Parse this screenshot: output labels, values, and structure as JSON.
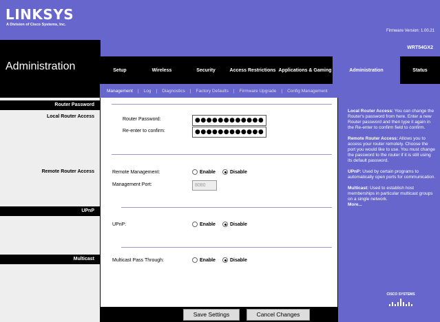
{
  "header": {
    "brand": "LINKSYS",
    "brand_sub": "A Division of Cisco Systems, Inc.",
    "firmware": "Firmware Version: 1.00.21",
    "model": "WRT54GX2",
    "page_title": "Administration"
  },
  "tabs": [
    {
      "label": "Setup",
      "active": false
    },
    {
      "label": "Wireless",
      "active": false
    },
    {
      "label": "Security",
      "active": false
    },
    {
      "label": "Access Restrictions",
      "active": false
    },
    {
      "label": "Applications & Gaming",
      "active": false
    },
    {
      "label": "Administration",
      "active": true
    },
    {
      "label": "Status",
      "active": false
    }
  ],
  "subnav": [
    {
      "label": "Management",
      "active": true
    },
    {
      "label": "Log",
      "active": false
    },
    {
      "label": "Diagnostics",
      "active": false
    },
    {
      "label": "Factory Defaults",
      "active": false
    },
    {
      "label": "Firmware Upgrade",
      "active": false
    },
    {
      "label": "Config Management",
      "active": false
    }
  ],
  "left": {
    "router_password": "Router Password",
    "local_access": "Local Router Access",
    "remote_access": "Remote Router Access",
    "upnp": "UPnP",
    "multicast": "Multicast"
  },
  "form": {
    "router_password_label": "Router Password:",
    "router_password_value": "●●●●●●●●●●●●",
    "reenter_label": "Re-enter to confirm:",
    "reenter_value": "●●●●●●●●●●●●",
    "remote_mgmt_label": "Remote Management:",
    "mgmt_port_label": "Management Port:",
    "mgmt_port_value": "8080",
    "upnp_label": "UPnP:",
    "multicast_label": "Multicast Pass Through:",
    "enable": "Enable",
    "disable": "Disable",
    "remote_mgmt_selected": "Disable",
    "upnp_selected": "Disable",
    "multicast_selected": "Disable"
  },
  "help": {
    "local_title": "Local Router Access:",
    "local_text": " You can change the Router's password from here. Enter a new Router password and then type it again in the Re-enter to confirm field to confirm.",
    "remote_title": "Remote Router Access:",
    "remote_text": " Allows you to access your router remotely. Choose the port you would like to use. You must change the password to the router if it is still using its default password.",
    "upnp_title": "UPnP:",
    "upnp_text": " Used by certain programs to automatically open ports for communication.",
    "multicast_title": "Multicast:",
    "multicast_text": " Used to establish host memberships in particular multicast groups on a single network.",
    "more": "More..."
  },
  "cisco": "CISCO SYSTEMS",
  "buttons": {
    "save": "Save Settings",
    "cancel": "Cancel Changes"
  },
  "colors": {
    "brand_purple": "#6666cc",
    "black": "#000000",
    "light_gray": "#eeeeee"
  }
}
